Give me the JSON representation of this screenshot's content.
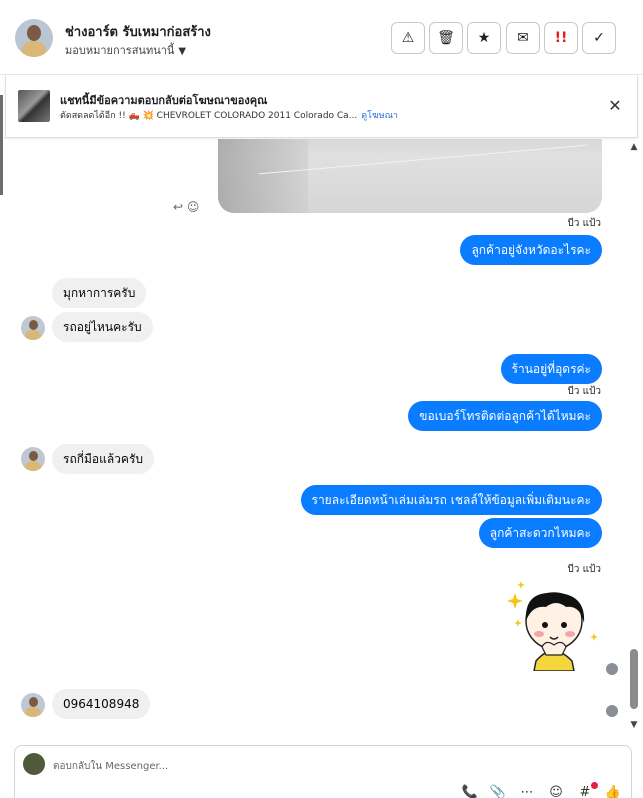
{
  "header": {
    "contact_name": "ช่างอาร์ต รับเหมาก่อสร้าง",
    "assign_label": "มอบหมายการสนทนานี้"
  },
  "toolbar": {
    "spam_icon": "⚠",
    "delete_icon": "🗑",
    "star_icon": "★",
    "mail_icon": "✉",
    "important_icon": "!!",
    "done_icon": "✓"
  },
  "ad_banner": {
    "title": "แชทนี้มีข้อความตอบกลับต่อโฆษณาของคุณ",
    "subtitle": "ตัดสดลดได้อีก !! 🛻 💥 CHEVROLET COLORADO 2011 Colorado Ca...",
    "link_label": "ดูโฆษณา",
    "close_icon": "✕"
  },
  "conversation": {
    "reaction_icons": "↩ ☺",
    "seen_label": "บีว แป้ว",
    "messages": [
      {
        "id": "m1",
        "direction": "out",
        "text": "ลูกค้าอยู่จังหวัดอะไรคะ"
      },
      {
        "id": "m2",
        "direction": "in",
        "text": "มุกหาการครับ"
      },
      {
        "id": "m3",
        "direction": "in",
        "text": "รถอยู่ไหนคะรับ"
      },
      {
        "id": "m4",
        "direction": "out",
        "text": "ร้านอยู่ที่อุดรค่ะ"
      },
      {
        "id": "m5",
        "direction": "out",
        "text": "ขอเบอร์โทรติดต่อลูกค้าได้ไหมคะ"
      },
      {
        "id": "m6",
        "direction": "in",
        "text": "รถกี่มือแล้วครับ"
      },
      {
        "id": "m7",
        "direction": "out",
        "text": "รายละเอียดหน้าเล่มเล่มรถ เชลล์ให้ข้อมูลเพิ่มเติมนะคะ"
      },
      {
        "id": "m8",
        "direction": "out",
        "text": "ลูกค้าสะดวกไหมคะ"
      },
      {
        "id": "m9",
        "direction": "in",
        "text": "0964108948"
      }
    ]
  },
  "composer": {
    "placeholder": "ตอบกลับใน Messenger...",
    "call_icon": "📞",
    "attach_icon": "📎",
    "more_icon": "⋯",
    "emoji_icon": "☺",
    "saved_icon": "#",
    "like_icon": "👍"
  },
  "scrollbar": {
    "up": "▲",
    "down": "▼"
  }
}
